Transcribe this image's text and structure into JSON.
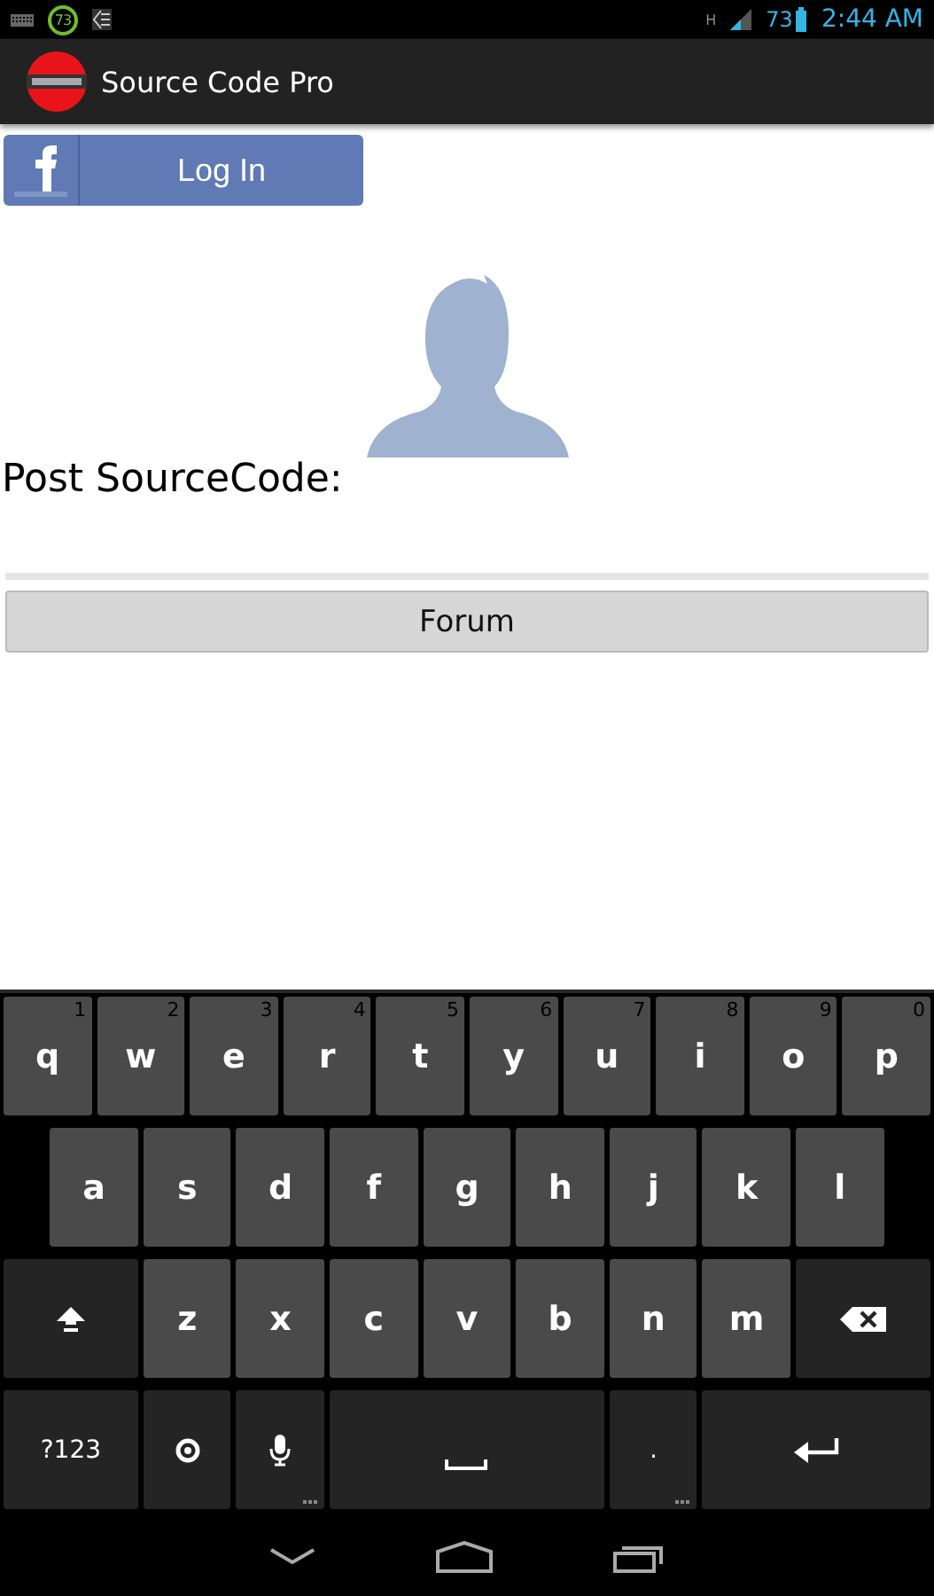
{
  "status_bar": {
    "notification_count": "73",
    "network_type": "H",
    "battery_level": "73",
    "time": "2:44 AM"
  },
  "app_bar": {
    "title": "Source Code Pro"
  },
  "login_button": {
    "label": "Log In"
  },
  "post_label": "Post SourceCode:",
  "forum_button": {
    "label": "Forum"
  },
  "keyboard": {
    "rows": [
      {
        "keys": [
          {
            "kind": "letter",
            "label": "q",
            "hint": "1"
          },
          {
            "kind": "letter",
            "label": "w",
            "hint": "2"
          },
          {
            "kind": "letter",
            "label": "e",
            "hint": "3"
          },
          {
            "kind": "letter",
            "label": "r",
            "hint": "4"
          },
          {
            "kind": "letter",
            "label": "t",
            "hint": "5"
          },
          {
            "kind": "letter",
            "label": "y",
            "hint": "6"
          },
          {
            "kind": "letter",
            "label": "u",
            "hint": "7"
          },
          {
            "kind": "letter",
            "label": "i",
            "hint": "8"
          },
          {
            "kind": "letter",
            "label": "o",
            "hint": "9"
          },
          {
            "kind": "letter",
            "label": "p",
            "hint": "0"
          }
        ]
      },
      {
        "keys": [
          {
            "kind": "letter",
            "label": "a"
          },
          {
            "kind": "letter",
            "label": "s"
          },
          {
            "kind": "letter",
            "label": "d"
          },
          {
            "kind": "letter",
            "label": "f"
          },
          {
            "kind": "letter",
            "label": "g"
          },
          {
            "kind": "letter",
            "label": "h"
          },
          {
            "kind": "letter",
            "label": "j"
          },
          {
            "kind": "letter",
            "label": "k"
          },
          {
            "kind": "letter",
            "label": "l"
          }
        ]
      },
      {
        "keys": [
          {
            "kind": "shift"
          },
          {
            "kind": "letter",
            "label": "z"
          },
          {
            "kind": "letter",
            "label": "x"
          },
          {
            "kind": "letter",
            "label": "c"
          },
          {
            "kind": "letter",
            "label": "v"
          },
          {
            "kind": "letter",
            "label": "b"
          },
          {
            "kind": "letter",
            "label": "n"
          },
          {
            "kind": "letter",
            "label": "m"
          },
          {
            "kind": "delete"
          }
        ]
      },
      {
        "keys": [
          {
            "kind": "symbols",
            "label": "?123"
          },
          {
            "kind": "emoji"
          },
          {
            "kind": "voice"
          },
          {
            "kind": "space"
          },
          {
            "kind": "punctuation",
            "label": "."
          },
          {
            "kind": "enter"
          }
        ]
      }
    ]
  }
}
